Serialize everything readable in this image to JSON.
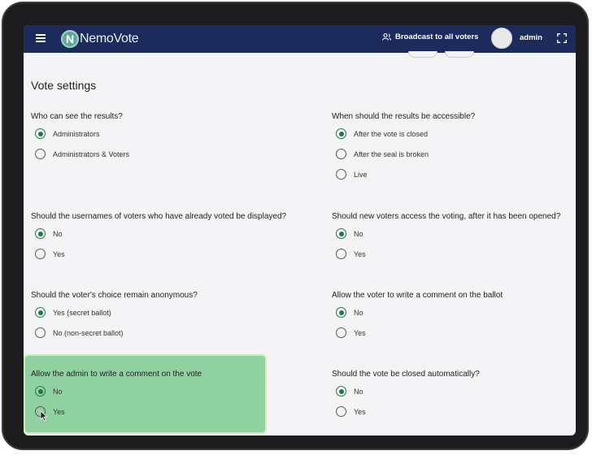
{
  "topbar": {
    "logo_mark": "N",
    "logo_text": "NemoVote",
    "broadcast_label": "Broadcast to all voters",
    "admin_name": "admin",
    "color": "#1d2a5c"
  },
  "section_title": "Vote settings",
  "left": [
    {
      "question": "Who can see the results?",
      "options": [
        {
          "label": "Administrators",
          "checked": true
        },
        {
          "label": "Administrators & Voters",
          "checked": false
        }
      ]
    },
    {
      "question": "Should the usernames of voters who have already voted be displayed?",
      "options": [
        {
          "label": "No",
          "checked": true
        },
        {
          "label": "Yes",
          "checked": false
        }
      ]
    },
    {
      "question": "Should the voter's choice remain anonymous?",
      "options": [
        {
          "label": "Yes (secret ballot)",
          "checked": true
        },
        {
          "label": "No (non-secret ballot)",
          "checked": false
        }
      ]
    },
    {
      "question": "Allow the admin to write a comment on the vote",
      "options": [
        {
          "label": "No",
          "checked": true
        },
        {
          "label": "Yes",
          "checked": false
        }
      ]
    }
  ],
  "right": [
    {
      "question": "When should the results be accessible?",
      "options": [
        {
          "label": "After the vote is closed",
          "checked": true
        },
        {
          "label": "After the seal is broken",
          "checked": false
        },
        {
          "label": "Live",
          "checked": false
        }
      ]
    },
    {
      "question": "Should new voters access the voting, after it has been opened?",
      "options": [
        {
          "label": "No",
          "checked": true
        },
        {
          "label": "Yes",
          "checked": false
        }
      ]
    },
    {
      "question": "Allow the voter to write a comment on the ballot",
      "options": [
        {
          "label": "No",
          "checked": true
        },
        {
          "label": "Yes",
          "checked": false
        }
      ]
    },
    {
      "question": "Should the vote be closed automatically?",
      "options": [
        {
          "label": "No",
          "checked": true
        },
        {
          "label": "Yes",
          "checked": false
        }
      ]
    }
  ],
  "colors": {
    "accent_green": "#1e7a43",
    "highlight": "#8fd1a0"
  }
}
